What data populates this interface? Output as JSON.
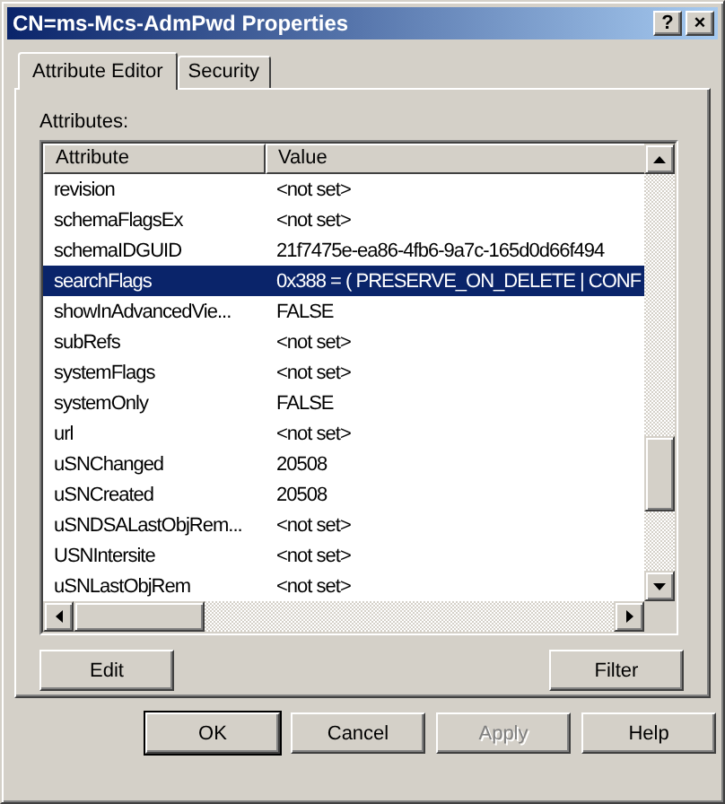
{
  "window": {
    "title": "CN=ms-Mcs-AdmPwd Properties",
    "help_button": "?",
    "close_button": "×"
  },
  "tabs": [
    {
      "label": "Attribute Editor",
      "selected": true
    },
    {
      "label": "Security",
      "selected": false
    }
  ],
  "attributes_label": "Attributes:",
  "table": {
    "columns": [
      "Attribute",
      "Value"
    ],
    "rows": [
      {
        "attribute": "revision",
        "value": "<not set>",
        "selected": false
      },
      {
        "attribute": "schemaFlagsEx",
        "value": "<not set>",
        "selected": false
      },
      {
        "attribute": "schemaIDGUID",
        "value": "21f7475e-ea86-4fb6-9a7c-165d0d66f494",
        "selected": false
      },
      {
        "attribute": "searchFlags",
        "value": "0x388 = ( PRESERVE_ON_DELETE | CONF",
        "selected": true
      },
      {
        "attribute": "showInAdvancedVie...",
        "value": "FALSE",
        "selected": false
      },
      {
        "attribute": "subRefs",
        "value": "<not set>",
        "selected": false
      },
      {
        "attribute": "systemFlags",
        "value": "<not set>",
        "selected": false
      },
      {
        "attribute": "systemOnly",
        "value": "FALSE",
        "selected": false
      },
      {
        "attribute": "url",
        "value": "<not set>",
        "selected": false
      },
      {
        "attribute": "uSNChanged",
        "value": "20508",
        "selected": false
      },
      {
        "attribute": "uSNCreated",
        "value": "20508",
        "selected": false
      },
      {
        "attribute": "uSNDSALastObjRem...",
        "value": "<not set>",
        "selected": false
      },
      {
        "attribute": "USNIntersite",
        "value": "<not set>",
        "selected": false
      },
      {
        "attribute": "uSNLastObjRem",
        "value": "<not set>",
        "selected": false
      }
    ]
  },
  "panel_buttons": [
    {
      "label": "Edit",
      "disabled": false
    },
    {
      "label": "Filter",
      "disabled": false
    }
  ],
  "dialog_buttons": [
    {
      "label": "OK",
      "default": true,
      "disabled": false
    },
    {
      "label": "Cancel",
      "default": false,
      "disabled": false
    },
    {
      "label": "Apply",
      "default": false,
      "disabled": true
    },
    {
      "label": "Help",
      "default": false,
      "disabled": false
    }
  ]
}
